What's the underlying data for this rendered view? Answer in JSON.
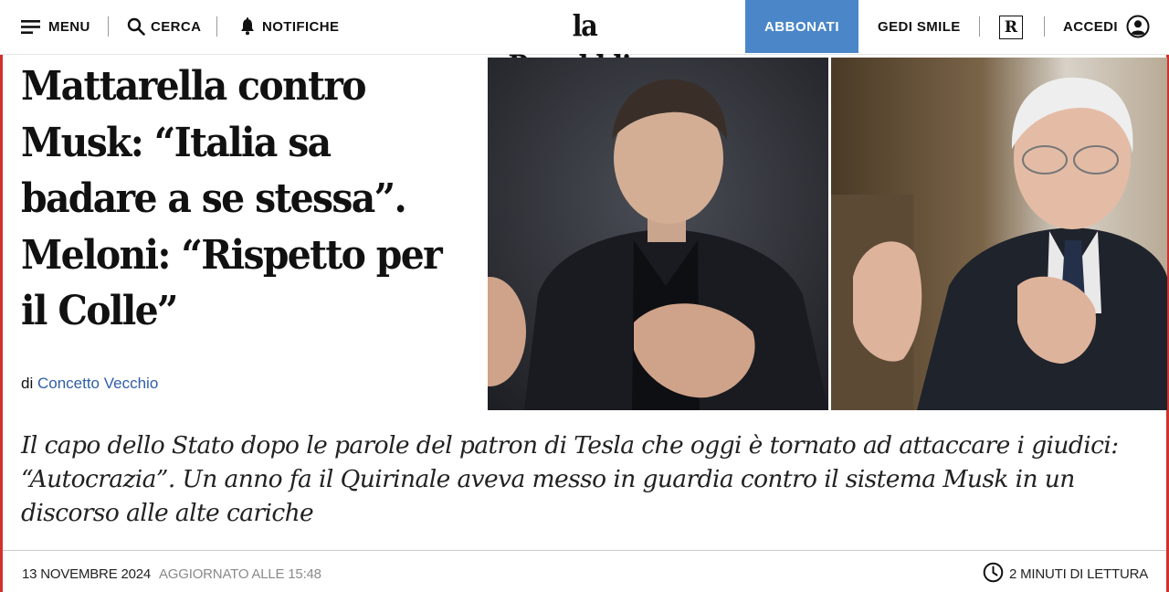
{
  "header": {
    "menu_label": "MENU",
    "search_label": "CERCA",
    "notifications_label": "NOTIFICHE",
    "logo_text": "la Repubblica",
    "subscribe_label": "ABBONATI",
    "gedi_label": "GEDI SMILE",
    "r_badge": "R",
    "login_label": "ACCEDI",
    "accent_color": "#4a86c8"
  },
  "article": {
    "headline_lines": [
      "Mattarella contro",
      "Musk: “Italia sa",
      "badare a se stessa”.",
      "Meloni: “Rispetto per",
      "il Colle”"
    ],
    "byline_prefix": "di",
    "author": "Concetto Vecchio",
    "summary": "Il capo dello Stato dopo le parole del patron di Tesla che oggi è tornato ad attaccare i giudici: “Autocrazia”. Un anno fa il Quirinale aveva messo in guardia contro il sistema Musk in un discorso alle alte cariche",
    "date": "13 NOVEMBRE 2024",
    "updated": "AGGIORNATO ALLE 15:48",
    "reading_time": "2 MINUTI DI LETTURA"
  },
  "icons": {
    "menu": "hamburger-icon",
    "search": "search-icon",
    "notifications": "bell-icon",
    "login": "user-icon",
    "reading_time": "clock-icon"
  },
  "colors": {
    "author_link": "#2f5ea8",
    "page_edge": "#d0312d"
  }
}
